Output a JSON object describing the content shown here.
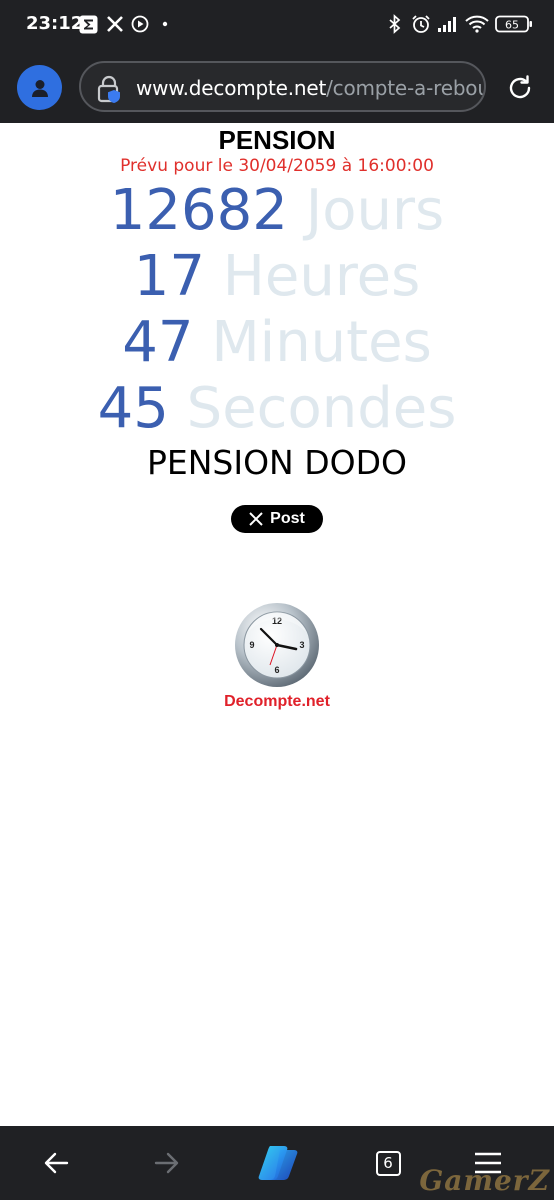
{
  "status_bar": {
    "time": "23:12",
    "battery": "65",
    "icons": [
      "sigma-app-icon",
      "x-app-icon",
      "play-circle-icon",
      "dot-icon",
      "bluetooth-icon",
      "alarm-icon",
      "signal-icon",
      "wifi-icon",
      "battery-icon"
    ]
  },
  "browser": {
    "url_domain": "www.decompte.net",
    "url_path": "/compte-a-rebours",
    "tabs_count": "6"
  },
  "page": {
    "title": "PENSION",
    "subtitle": "Prévu pour le 30/04/2059 à 16:00:00",
    "countdown": {
      "days": {
        "value": "12682",
        "unit": "Jours"
      },
      "hours": {
        "value": "17",
        "unit": "Heures"
      },
      "minutes": {
        "value": "47",
        "unit": "Minutes"
      },
      "seconds": {
        "value": "45",
        "unit": "Secondes"
      }
    },
    "label": "PENSION DODO",
    "post_button": "Post",
    "brand": "Decompte.net"
  },
  "watermark": "GamerZ",
  "colors": {
    "number": "#3b5fb0",
    "unit": "#dfe8ee",
    "subtitle": "#e0302c",
    "brand": "#e0212a",
    "chrome": "#202124",
    "avatar": "#2f6fe0"
  }
}
